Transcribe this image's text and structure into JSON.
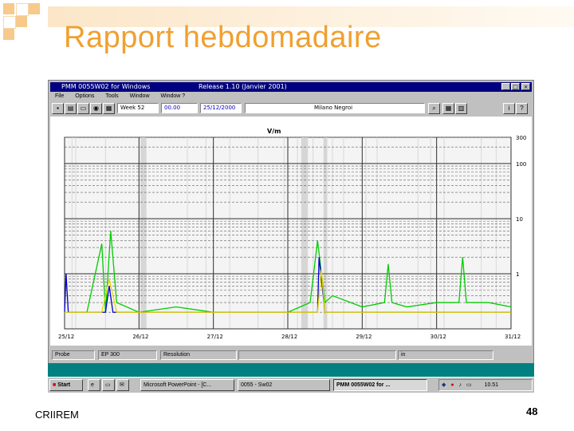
{
  "slide": {
    "title": "Rapport hebdomadaire",
    "footer_left": "CRIIREM",
    "page_number": "48",
    "accent_color": "#f0a030"
  },
  "window": {
    "title": "PMM 0055W02 for Windows",
    "release": "Release 1.10 (Janvier 2001)",
    "controls": {
      "minimize": "_",
      "maximize": "□",
      "close": "×"
    }
  },
  "menu": [
    "File",
    "Options",
    "Tools",
    "Window",
    "Window ?"
  ],
  "toolbar": {
    "icons": [
      "save-icon",
      "print-icon",
      "open-icon",
      "camera-icon",
      "chart-icon",
      "zoom-icon",
      "grid-icon",
      "table-icon",
      "info-icon",
      "help-icon"
    ],
    "week": "Week 52",
    "time": "00.00",
    "date": "25/12/2000",
    "location": "Milano Negroi"
  },
  "status": {
    "probe_label": "Probe",
    "probe_value": "EP 300",
    "resolution_label": "Resolution",
    "unit": "in"
  },
  "taskbar": {
    "start": "Start",
    "items": [
      "Microsoft PowerPoint - [C...",
      "0055 - Sw02",
      "PMM 0055W02 for ..."
    ],
    "clock": "10.51"
  },
  "chart_data": {
    "type": "line",
    "title": "V/m",
    "y_scale": "log",
    "ylim": [
      0.1,
      300
    ],
    "y_ticks": [
      1,
      10,
      100,
      300
    ],
    "x_tick_labels": [
      "25/12",
      "26/12",
      "27/12",
      "28/12",
      "29/12",
      "30/12",
      "31/12"
    ],
    "series": [
      {
        "color": "#00cc00",
        "x": [
          0,
          0.3,
          0.5,
          0.55,
          0.62,
          0.7,
          1.0,
          1.5,
          2.0,
          2.5,
          3.0,
          3.3,
          3.4,
          3.5,
          3.6,
          4.0,
          4.3,
          4.35,
          4.4,
          4.6,
          5.0,
          5.3,
          5.35,
          5.4,
          5.7,
          6.0
        ],
        "values": [
          0.2,
          0.2,
          3.5,
          0.2,
          6.0,
          0.3,
          0.2,
          0.25,
          0.2,
          0.2,
          0.2,
          0.3,
          4.0,
          0.3,
          0.4,
          0.25,
          0.3,
          1.5,
          0.3,
          0.25,
          0.3,
          0.3,
          2.0,
          0.3,
          0.3,
          0.25
        ]
      },
      {
        "color": "#0000cc",
        "x": [
          0,
          0.02,
          0.05,
          0.3,
          0.55,
          0.6,
          0.65,
          1.0,
          3.4,
          3.42,
          3.5,
          4.0,
          5.0,
          6.0
        ],
        "values": [
          0.2,
          1.0,
          0.2,
          0.2,
          0.2,
          0.6,
          0.2,
          0.2,
          0.2,
          2.0,
          0.2,
          0.2,
          0.2,
          0.2
        ]
      },
      {
        "color": "#e6d800",
        "x": [
          0,
          0.5,
          0.6,
          0.7,
          1.0,
          2.0,
          3.0,
          3.4,
          3.45,
          3.5,
          4.0,
          5.0,
          6.0
        ],
        "values": [
          0.2,
          0.2,
          0.8,
          0.2,
          0.2,
          0.2,
          0.2,
          0.2,
          1.2,
          0.2,
          0.2,
          0.2,
          0.2
        ]
      }
    ]
  }
}
